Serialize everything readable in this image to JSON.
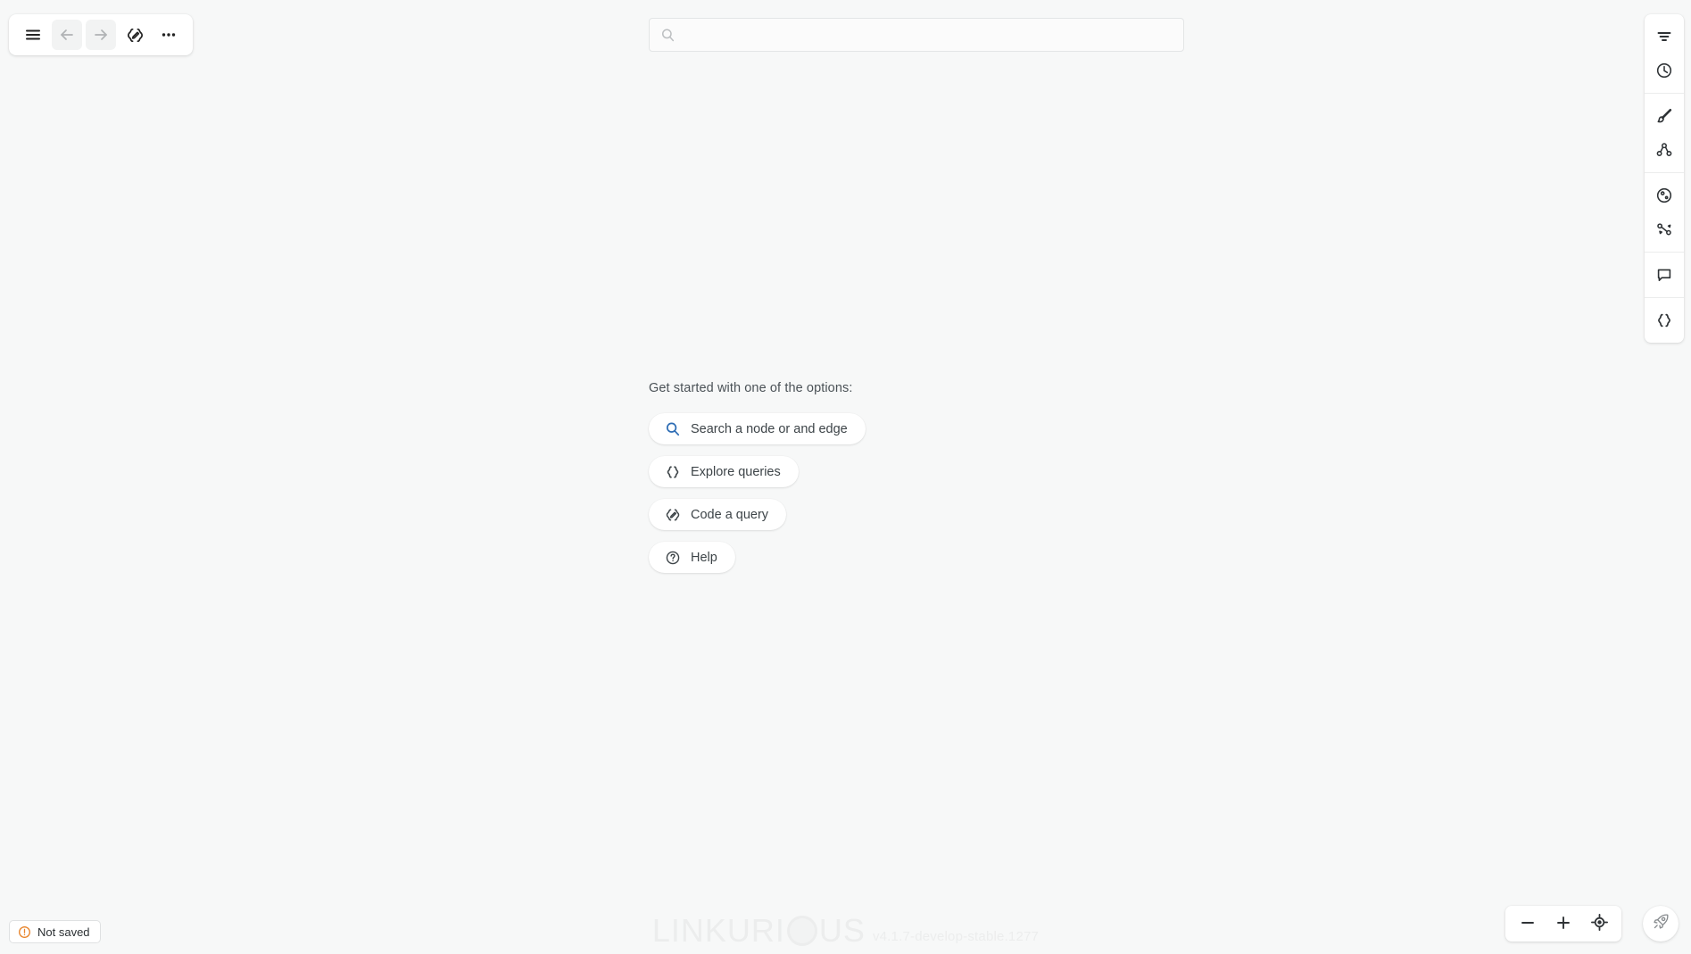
{
  "app": {
    "name": "Linkurious",
    "canvas_background": "#f7f8f8",
    "accent_blue": "#2c6cb4",
    "warning_orange": "#e8842a"
  },
  "toolbar": {
    "menu_label": "",
    "back_label": "",
    "forward_label": "",
    "query_label": "",
    "more_label": "",
    "items": [
      {
        "name": "menu-button",
        "icon": "hamburger-menu-icon",
        "enabled": true
      },
      {
        "name": "back-button",
        "icon": "arrow-left-icon",
        "enabled": false
      },
      {
        "name": "forward-button",
        "icon": "arrow-right-icon",
        "enabled": false
      },
      {
        "name": "edit-query-button",
        "icon": "code-pencil-icon",
        "enabled": true
      },
      {
        "name": "more-options-button",
        "icon": "ellipsis-icon",
        "enabled": true
      }
    ]
  },
  "search": {
    "value": "",
    "placeholder": "",
    "icon": "search-icon"
  },
  "right_rail": {
    "groups": [
      {
        "items": [
          {
            "name": "filters-button",
            "icon": "filter-icon",
            "label": "Filters"
          },
          {
            "name": "history-button",
            "icon": "clock-history-icon",
            "label": "History"
          }
        ]
      },
      {
        "items": [
          {
            "name": "styles-button",
            "icon": "brush-icon",
            "label": "Styles"
          },
          {
            "name": "layout-button",
            "icon": "graph-nodes-icon",
            "label": "Layout"
          }
        ]
      },
      {
        "items": [
          {
            "name": "node-design-button",
            "icon": "palette-circle-icon",
            "label": "Design"
          },
          {
            "name": "pathfinding-button",
            "icon": "path-link-icon",
            "label": "Path finding"
          }
        ]
      },
      {
        "items": [
          {
            "name": "comments-button",
            "icon": "comment-bubble-icon",
            "label": "Comments"
          }
        ]
      },
      {
        "items": [
          {
            "name": "query-panel-button",
            "icon": "code-braces-icon",
            "label": "Queries"
          }
        ]
      }
    ]
  },
  "get_started": {
    "title": "Get started with one of the options:",
    "options": [
      {
        "name": "search-node-edge-button",
        "label": "Search a node or and edge",
        "icon": "search-icon",
        "icon_color": "blue"
      },
      {
        "name": "explore-queries-button",
        "label": "Explore queries",
        "icon": "code-braces-icon",
        "icon_color": "dark"
      },
      {
        "name": "code-a-query-button",
        "label": "Code a query",
        "icon": "code-pencil-icon",
        "icon_color": "dark"
      },
      {
        "name": "help-button",
        "label": "Help",
        "icon": "question-circle-icon",
        "icon_color": "dark"
      }
    ]
  },
  "status": {
    "not_saved_label": "Not saved",
    "not_saved_icon": "alert-circle-icon"
  },
  "watermark": {
    "logo_part_1": "LINKURI",
    "logo_part_2": "US",
    "version": "v4.1.7-develop-stable.1277"
  },
  "zoom_controls": {
    "zoom_out_label": "",
    "zoom_in_label": "",
    "recenter_label": "",
    "items": [
      {
        "name": "zoom-out-button",
        "icon": "minus-icon"
      },
      {
        "name": "zoom-in-button",
        "icon": "plus-icon"
      },
      {
        "name": "recenter-button",
        "icon": "crosshair-target-icon"
      }
    ],
    "rocket": {
      "name": "boost-button",
      "icon": "rocket-icon"
    }
  }
}
